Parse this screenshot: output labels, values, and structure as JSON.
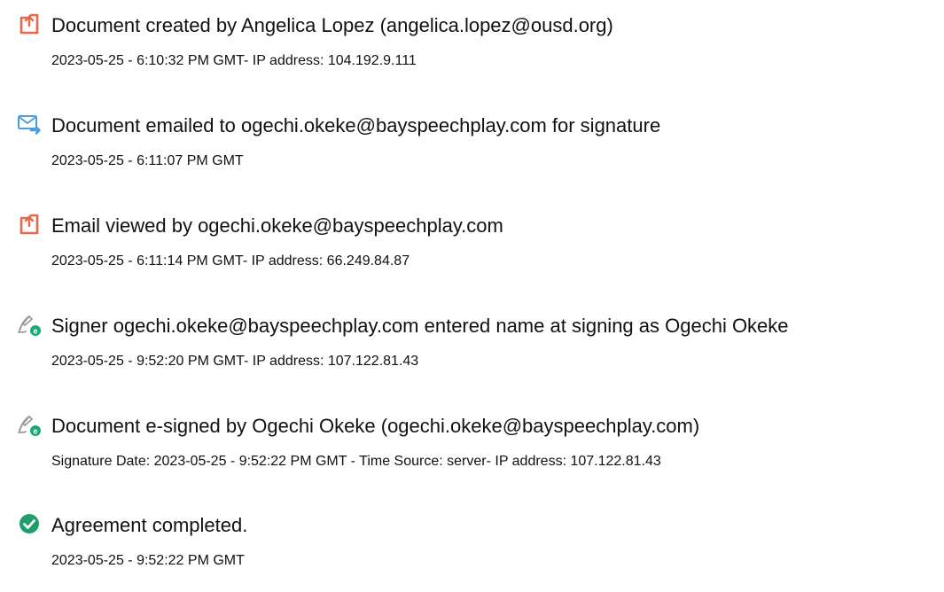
{
  "colors": {
    "accent_orange": "#E8674A",
    "email_blue": "#4A9EE0",
    "signed_green": "#19A974",
    "complete_green": "#1E9E6A"
  },
  "events": [
    {
      "icon": "document-created-icon",
      "title": "Document created by Angelica Lopez (angelica.lopez@ousd.org)",
      "detail": "2023-05-25 - 6:10:32 PM GMT- IP address: 104.192.9.111"
    },
    {
      "icon": "email-sent-icon",
      "title": "Document emailed to ogechi.okeke@bayspeechplay.com for signature",
      "detail": "2023-05-25 - 6:11:07 PM GMT"
    },
    {
      "icon": "email-viewed-icon",
      "title": "Email viewed by ogechi.okeke@bayspeechplay.com",
      "detail": "2023-05-25 - 6:11:14 PM GMT- IP address: 66.249.84.87"
    },
    {
      "icon": "signer-pen-icon",
      "title": "Signer ogechi.okeke@bayspeechplay.com entered name at signing as Ogechi Okeke",
      "detail": "2023-05-25 - 9:52:20 PM GMT- IP address: 107.122.81.43"
    },
    {
      "icon": "esign-pen-icon",
      "title": "Document e-signed by Ogechi Okeke (ogechi.okeke@bayspeechplay.com)",
      "detail": "Signature Date: 2023-05-25 - 9:52:22 PM GMT - Time Source: server- IP address: 107.122.81.43"
    },
    {
      "icon": "check-circle-icon",
      "title": "Agreement completed.",
      "detail": "2023-05-25 - 9:52:22 PM GMT"
    }
  ]
}
